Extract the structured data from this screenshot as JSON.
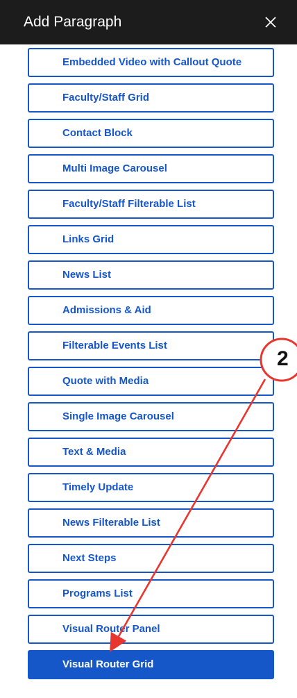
{
  "header": {
    "title": "Add Paragraph",
    "close_icon": "close-icon"
  },
  "items": [
    {
      "label": "Embedded Video with Callout Quote"
    },
    {
      "label": "Faculty/Staff Grid"
    },
    {
      "label": "Contact Block"
    },
    {
      "label": "Multi Image Carousel"
    },
    {
      "label": "Faculty/Staff Filterable List"
    },
    {
      "label": "Links Grid"
    },
    {
      "label": "News List"
    },
    {
      "label": "Admissions & Aid"
    },
    {
      "label": "Filterable Events List"
    },
    {
      "label": "Quote with Media"
    },
    {
      "label": "Single Image Carousel"
    },
    {
      "label": "Text & Media"
    },
    {
      "label": "Timely Update"
    },
    {
      "label": "News Filterable List"
    },
    {
      "label": "Next Steps"
    },
    {
      "label": "Programs List"
    },
    {
      "label": "Visual Router Panel"
    },
    {
      "label": "Visual Router Grid",
      "selected": true
    }
  ],
  "annotation": {
    "step_number": "2"
  },
  "colors": {
    "header_bg": "#1c1c1c",
    "accent": "#1556c8",
    "annotation": "#e8362f"
  }
}
